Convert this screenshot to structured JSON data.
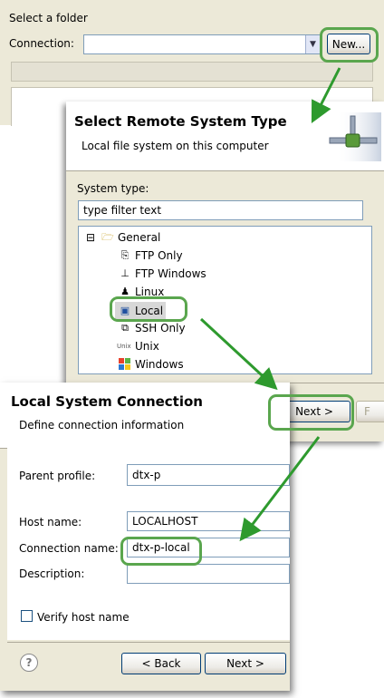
{
  "folder_panel": {
    "title": "Select a folder",
    "connection_label": "Connection:",
    "connection_value": "",
    "new_button": "New..."
  },
  "remote_dialog": {
    "title": "Select Remote System Type",
    "subtitle": "Local file system on this computer",
    "system_type_label": "System type:",
    "filter_value": "type filter text",
    "tree_root": "General",
    "tree_items": [
      "FTP Only",
      "FTP Windows",
      "Linux",
      "Local",
      "SSH Only",
      "Unix",
      "Windows"
    ],
    "selected_item": "Local",
    "next_button": "Next >",
    "finish_button_partial": "F"
  },
  "local_dialog": {
    "title": "Local System Connection",
    "subtitle": "Define connection information",
    "parent_profile_label": "Parent profile:",
    "parent_profile_value": "dtx-p",
    "host_name_label": "Host name:",
    "host_name_value": "LOCALHOST",
    "connection_name_label": "Connection name:",
    "connection_name_value": "dtx-p-local",
    "description_label": "Description:",
    "description_value": "",
    "verify_label": "Verify host name",
    "verify_checked": false,
    "help_icon": "?",
    "back_button": "< Back",
    "next_button": "Next >"
  },
  "colors": {
    "highlight": "#5aa64e",
    "arrow": "#2e9a2e",
    "dialog_bg": "#ece9d8"
  }
}
